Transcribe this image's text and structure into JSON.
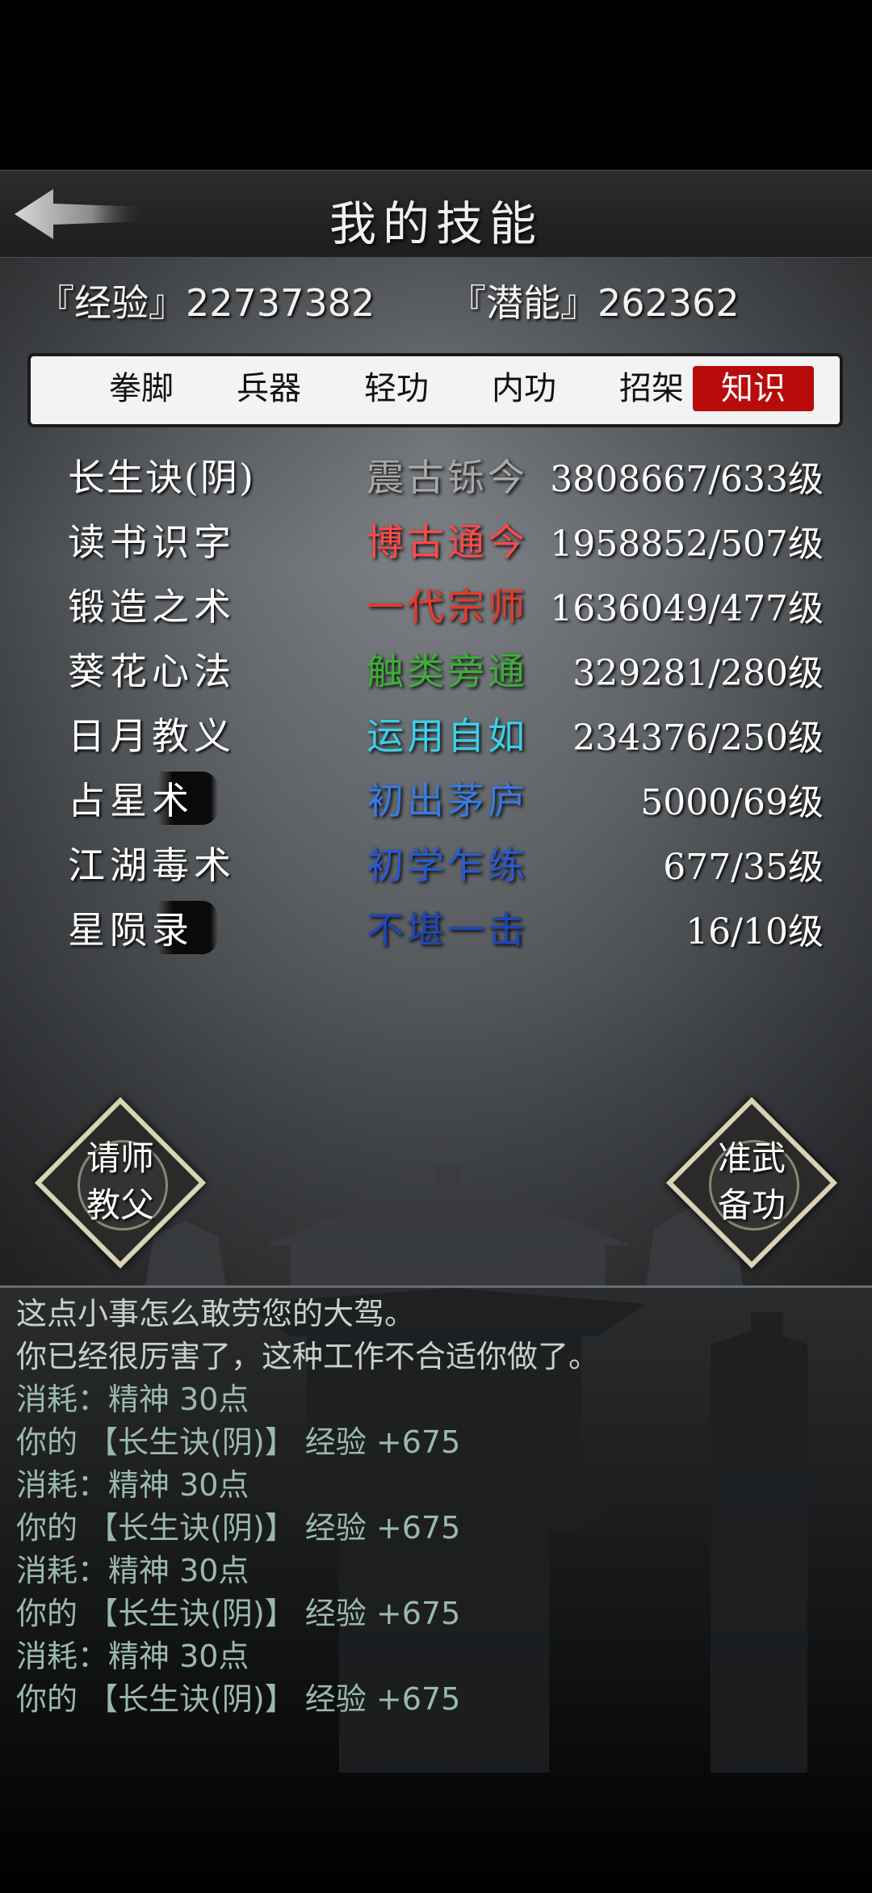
{
  "header": {
    "title": "我的技能"
  },
  "stats": {
    "experience": "『经验』22737382",
    "potential": "『潜能』262362"
  },
  "tabs": [
    "拳脚",
    "兵器",
    "轻功",
    "内功",
    "招架",
    "知识"
  ],
  "active_tab": "知识",
  "skills": [
    {
      "name": "长生诀(阴)",
      "rank": "震古铄今",
      "rank_color": "#a9a9a9",
      "level": "3808667/633级"
    },
    {
      "name": "读书识字",
      "rank": "博古通今",
      "rank_color": "#ff4a4a",
      "level": "1958852/507级"
    },
    {
      "name": "锻造之术",
      "rank": "一代宗师",
      "rank_color": "#e83a2a",
      "level": "1636049/477级"
    },
    {
      "name": "葵花心法",
      "rank": "触类旁通",
      "rank_color": "#3fae3a",
      "level": "329281/280级"
    },
    {
      "name": "日月教义",
      "rank": "运用自如",
      "rank_color": "#3ad0e8",
      "level": "234376/250级"
    },
    {
      "name": "占星术",
      "rank": "初出茅庐",
      "rank_color": "#3a7ae0",
      "level": "5000/69级"
    },
    {
      "name": "江湖毒术",
      "rank": "初学乍练",
      "rank_color": "#2a5ad0",
      "level": "677/35级"
    },
    {
      "name": "星陨录",
      "rank": "不堪一击",
      "rank_color": "#1f46b8",
      "level": "16/10级"
    }
  ],
  "buttons": {
    "ask_master": {
      "line1": "请师",
      "line2": "教父"
    },
    "prepare_skill": {
      "line1": "准武",
      "line2": "备功"
    }
  },
  "log": [
    "这点小事怎么敢劳您的大驾。",
    "你已经很厉害了，这种工作不合适你做了。",
    "消耗：精神 30点",
    "你的 【长生诀(阴)】 经验 +675",
    "消耗：精神 30点",
    "你的 【长生诀(阴)】 经验 +675",
    "消耗：精神 30点",
    "你的 【长生诀(阴)】 经验 +675",
    "消耗：精神 30点",
    "你的 【长生诀(阴)】 经验 +675"
  ]
}
